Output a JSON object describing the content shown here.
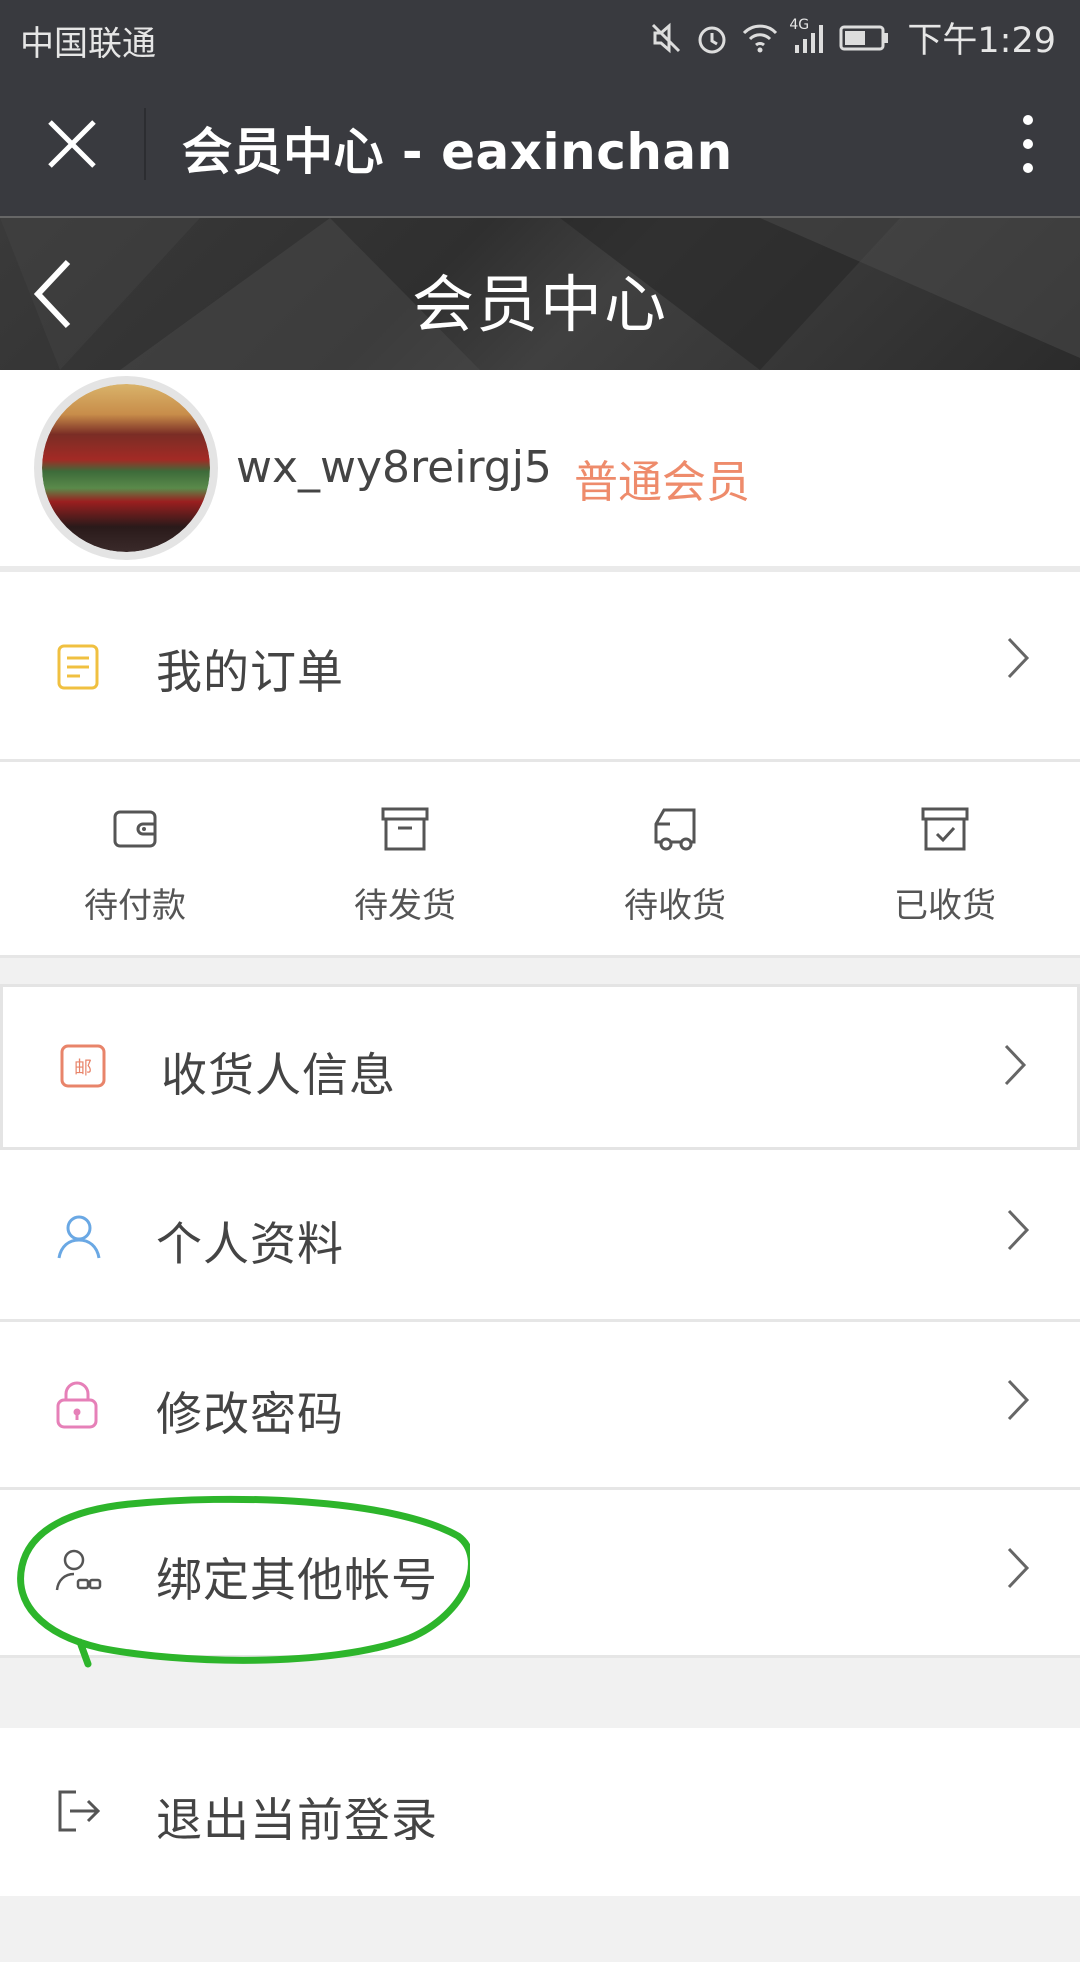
{
  "status_bar": {
    "carrier": "中国联通",
    "network": "4G",
    "time": "下午1:29"
  },
  "wechat_bar": {
    "title": "会员中心 - eaxinchan"
  },
  "page_header": {
    "title": "会员中心"
  },
  "profile": {
    "username": "wx_wy8reirgj5",
    "level": "普通会员"
  },
  "menu": {
    "my_orders": "我的订单",
    "order_status": [
      {
        "label": "待付款",
        "icon": "wallet-icon"
      },
      {
        "label": "待发货",
        "icon": "box-icon"
      },
      {
        "label": "待收货",
        "icon": "truck-icon"
      },
      {
        "label": "已收货",
        "icon": "received-box-icon"
      }
    ],
    "consignee": "收货人信息",
    "personal_info": "个人资料",
    "change_password": "修改密码",
    "bind_account": "绑定其他帐号",
    "logout": "退出当前登录"
  },
  "colors": {
    "bar_bg": "#393a3f",
    "level_color": "#ee8b6b",
    "annotation_green": "#2db52b"
  }
}
